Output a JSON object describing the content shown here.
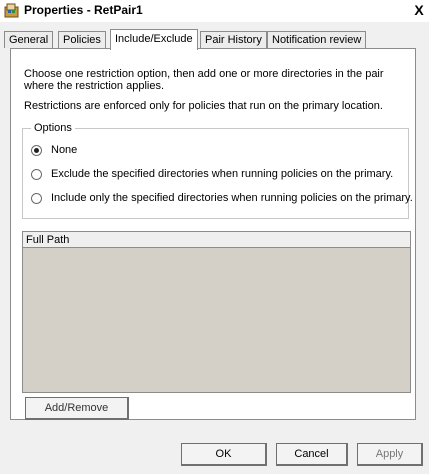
{
  "window": {
    "title": "Properties - RetPair1",
    "close_label": "X"
  },
  "tabs": [
    {
      "label": "General"
    },
    {
      "label": "Policies"
    },
    {
      "label": "Include/Exclude"
    },
    {
      "label": "Pair History"
    },
    {
      "label": "Notification review"
    }
  ],
  "panel": {
    "description1": "Choose one restriction option, then add one or more directories in the pair where the restriction applies.",
    "description2": "Restrictions are enforced only for policies that run on the primary location.",
    "options_legend": "Options",
    "options": [
      {
        "label": "None",
        "selected": true
      },
      {
        "label": "Exclude the specified directories when running policies on the primary.",
        "selected": false
      },
      {
        "label": "Include only the specified directories when running policies on the primary.",
        "selected": false
      }
    ],
    "list": {
      "columns": [
        "Full Path"
      ],
      "rows": []
    },
    "add_remove_label": "Add/Remove"
  },
  "footer": {
    "ok_label": "OK",
    "cancel_label": "Cancel",
    "apply_label": "Apply"
  }
}
